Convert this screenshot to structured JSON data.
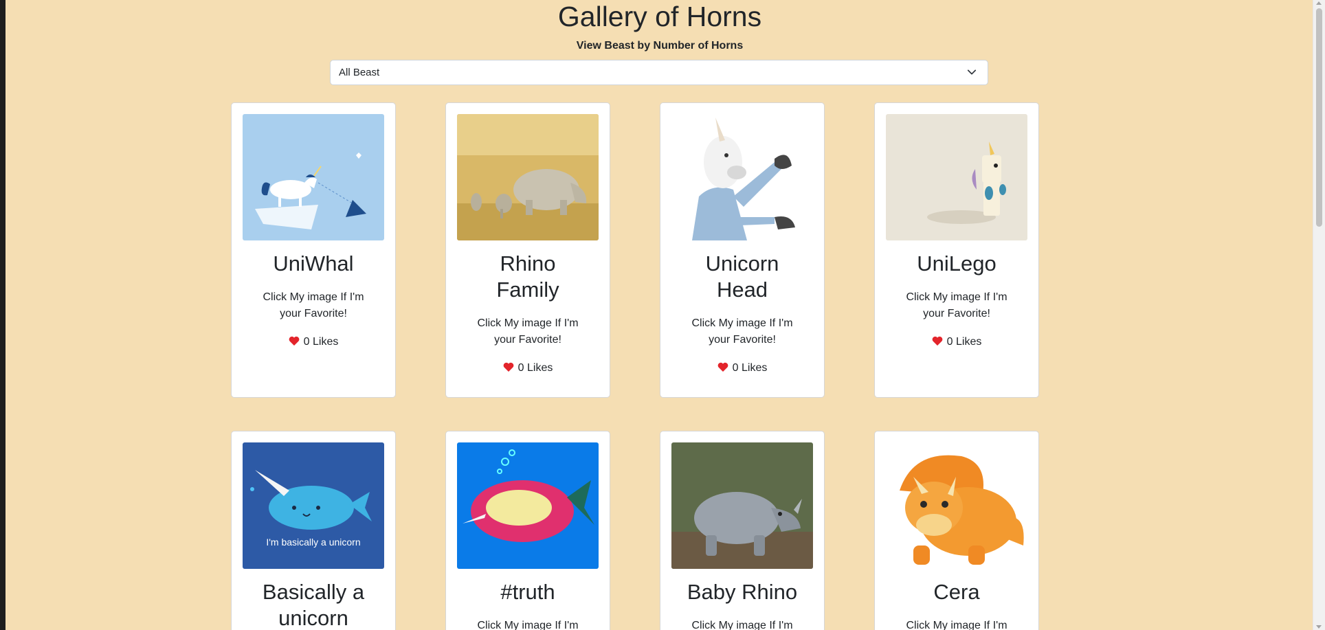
{
  "header": {
    "title": "Gallery of Horns",
    "subtitle": "View Beast by Number of Horns"
  },
  "filter": {
    "selected": "All Beast"
  },
  "cards": [
    {
      "title": "UniWhal",
      "title2": "",
      "text": "Click My image If I'm",
      "text2": "your Favorite!",
      "likes": "0 Likes",
      "image": "unicorn-narwhal-illustration"
    },
    {
      "title": "Rhino",
      "title2": "Family",
      "text": "Click My image If I'm",
      "text2": "your Favorite!",
      "likes": "0 Likes",
      "image": "rhino-family-photo"
    },
    {
      "title": "Unicorn",
      "title2": "Head",
      "text": "Click My image If I'm",
      "text2": "your Favorite!",
      "likes": "0 Likes",
      "image": "unicorn-mask-person-photo"
    },
    {
      "title": "UniLego",
      "title2": "",
      "text": "Click My image If I'm",
      "text2": "your Favorite!",
      "likes": "0 Likes",
      "image": "lego-unicorn-photo"
    },
    {
      "title": "Basically a",
      "title2": "unicorn",
      "text": "",
      "text2": "",
      "likes": "",
      "image": "narwhal-cartoon",
      "image_caption": "I'm basically a unicorn"
    },
    {
      "title": "#truth",
      "title2": "",
      "text": "Click My image If I'm",
      "text2": "",
      "likes": "",
      "image": "unicorn-inside-whal-cartoon"
    },
    {
      "title": "Baby Rhino",
      "title2": "",
      "text": "Click My image If I'm",
      "text2": "",
      "likes": "",
      "image": "baby-rhino-photo"
    },
    {
      "title": "Cera",
      "title2": "",
      "text": "Click My image If I'm",
      "text2": "",
      "likes": "",
      "image": "triceratops-cartoon"
    }
  ],
  "colors": {
    "background": "#f5deb3",
    "heart": "#e3242b"
  }
}
